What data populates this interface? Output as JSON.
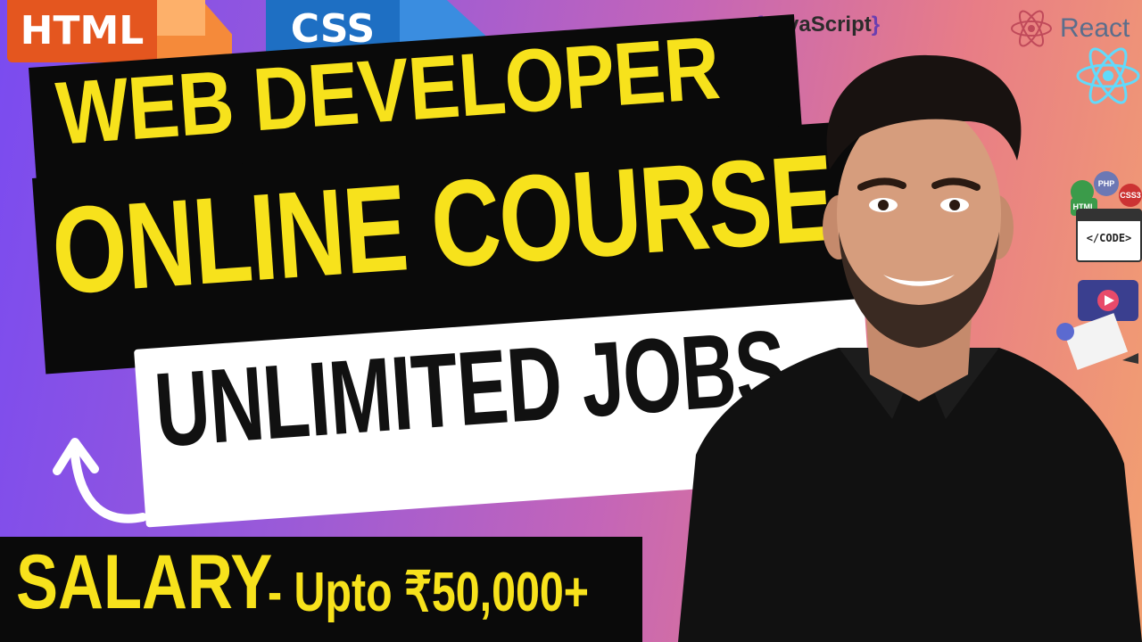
{
  "badges": {
    "html": "HTML",
    "css": "CSS",
    "javascript": "JavaScript",
    "javascript_open_brace": "{",
    "javascript_close_brace": "}",
    "react": "React"
  },
  "headline": {
    "line1": "WEB DEVELOPER",
    "line2": "ONLINE COURSE",
    "line3": "UNLIMITED JOBS"
  },
  "salary": {
    "label": "SALARY",
    "value": "- Upto ₹50,000+"
  },
  "code_icons": {
    "php": "PHP",
    "css3": "CSS3",
    "html": "HTML",
    "code": "</CODE>"
  },
  "colors": {
    "headline_yellow": "#f7e21c",
    "box_black": "#0a0a0a",
    "html_orange": "#e4561f",
    "css_blue": "#1e6fc3",
    "react_blue": "#61dafb"
  },
  "icons": [
    "html-badge-icon",
    "css-badge-icon",
    "javascript-logo-icon",
    "react-logo-icon",
    "code-window-icon",
    "curved-arrow-icon"
  ]
}
